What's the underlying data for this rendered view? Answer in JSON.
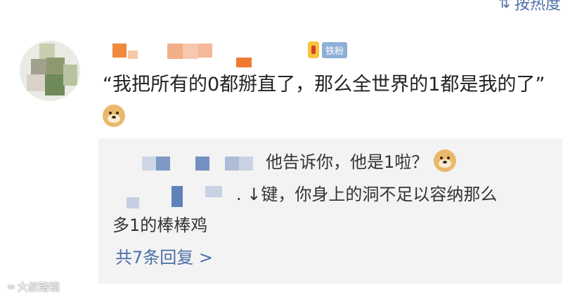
{
  "header": {
    "sort_label": "按热度"
  },
  "comment": {
    "fan_badge": "铁粉",
    "text": "“我把所有的0都掰直了，那么全世界的1都是我的了”"
  },
  "replies": {
    "items": [
      {
        "text": "他告诉你，他是1啦？"
      },
      {
        "prefix": ". ↓键，你身上的洞不足以容纳那么",
        "continuation": "多1的棒棒鸡"
      }
    ],
    "more_label": "共7条回复 >"
  },
  "watermark": {
    "logo": "∞",
    "text": "大叔踏镜"
  },
  "colors": {
    "link": "#4a6fa5",
    "reply_bg": "#f3f3f3",
    "badge": "#8fb0d6",
    "text": "#222222"
  }
}
